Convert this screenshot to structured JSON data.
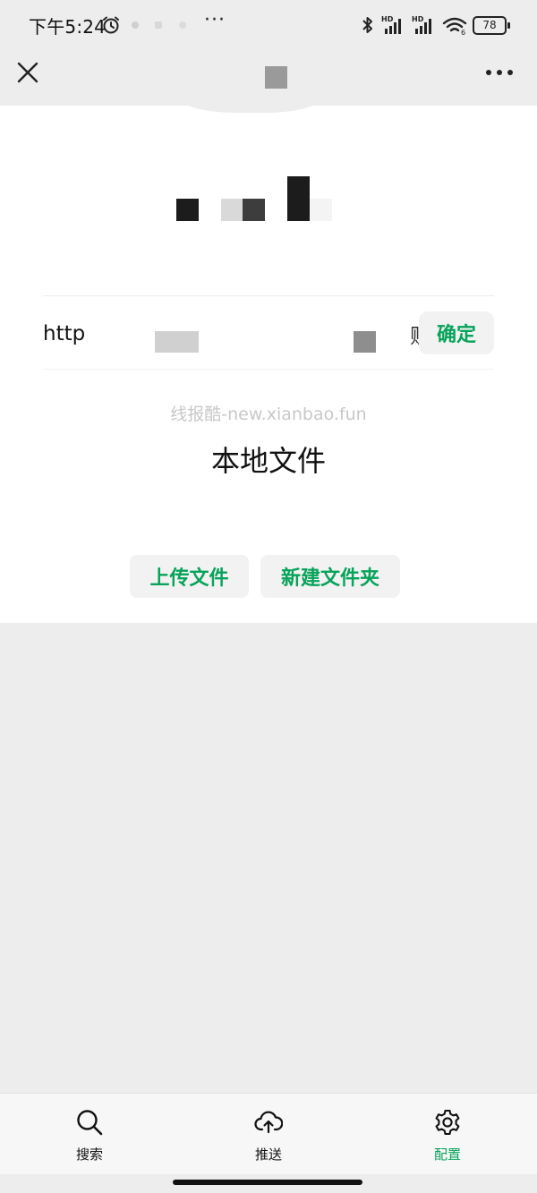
{
  "status_bar": {
    "time": "下午5:24",
    "battery": "78",
    "more": "···",
    "hd_label": "HD",
    "wifi_sub": "6"
  },
  "nav": {
    "close_icon": "close-icon",
    "more_icon": "more-horizontal-icon"
  },
  "url_bar": {
    "value": "http",
    "tail": "贩",
    "confirm_label": "确定"
  },
  "watermark": "线报酷-new.xianbao.fun",
  "section_title": "本地文件",
  "actions": {
    "upload_label": "上传文件",
    "new_folder_label": "新建文件夹"
  },
  "tabs": [
    {
      "label": "搜索",
      "icon": "search-icon",
      "active": false
    },
    {
      "label": "推送",
      "icon": "upload-cloud-icon",
      "active": false
    },
    {
      "label": "配置",
      "icon": "gear-icon",
      "active": true
    }
  ],
  "colors": {
    "accent": "#07a35a",
    "background": "#ededed",
    "panel": "#ffffff"
  }
}
